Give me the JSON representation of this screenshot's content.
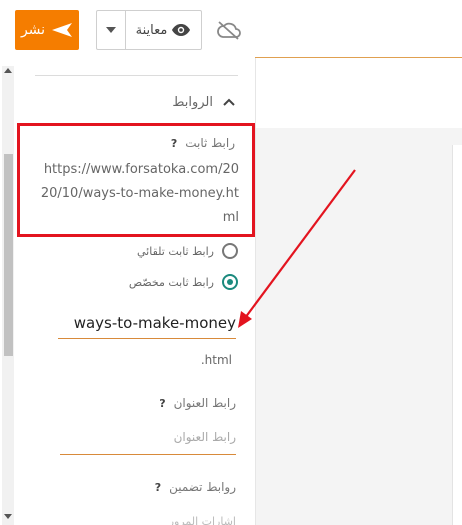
{
  "toolbar": {
    "publish_label": "نشر",
    "preview_label": "معاينة"
  },
  "icons": {
    "publish": "send-icon",
    "preview": "eye-icon",
    "dropdown": "caret-down-icon",
    "sync": "cloud-off-icon",
    "collapse": "chevron-up-icon",
    "help": "question-icon"
  },
  "sidebar": {
    "section_title": "الروابط",
    "permalink": {
      "label": "رابط ثابت",
      "help": "?",
      "url": "https://www.forsatoka.com/2020/10/ways-to-make-money.html"
    },
    "radio_auto_label": "رابط ثابت تلقائي",
    "radio_custom_label": "رابط ثابت مخصّص",
    "selected_option": "custom",
    "slug_value": "ways-to-make-money",
    "slug_suffix": ".html",
    "title_link": {
      "label": "رابط العنوان",
      "help": "?",
      "placeholder": "رابط العنوان"
    },
    "embed_links": {
      "label": "روابط تضمين",
      "help": "?"
    },
    "faded_label": "إشارات المرور"
  },
  "colors": {
    "publish_bg": "#f57d00",
    "highlight_border": "#e3141f",
    "radio_selected": "#1b8a7e",
    "input_underline": "#d88a3a"
  }
}
